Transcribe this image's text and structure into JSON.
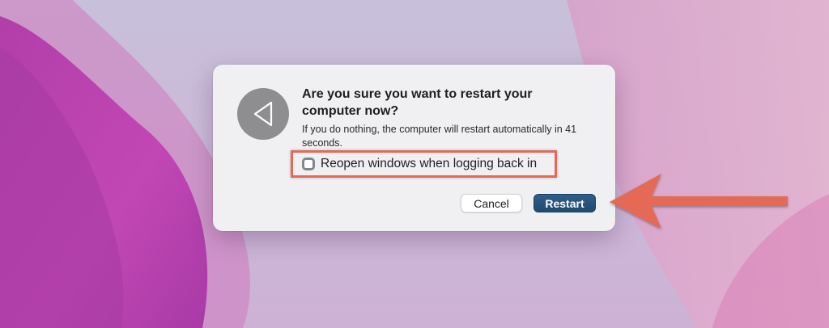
{
  "dialog": {
    "title": "Are you sure you want to restart your computer now?",
    "message": "If you do nothing, the computer will restart automatically in 41 seconds.",
    "checkbox": {
      "label": "Reopen windows when logging back in",
      "checked": false
    },
    "buttons": {
      "cancel_label": "Cancel",
      "restart_label": "Restart"
    },
    "icon": "restart-triangle-icon"
  },
  "colors": {
    "dialog_background": "#f0eff2",
    "primary_button": "#244f77",
    "highlight_annotation": "#e46a55",
    "icon_circle": "#8e8e90"
  }
}
